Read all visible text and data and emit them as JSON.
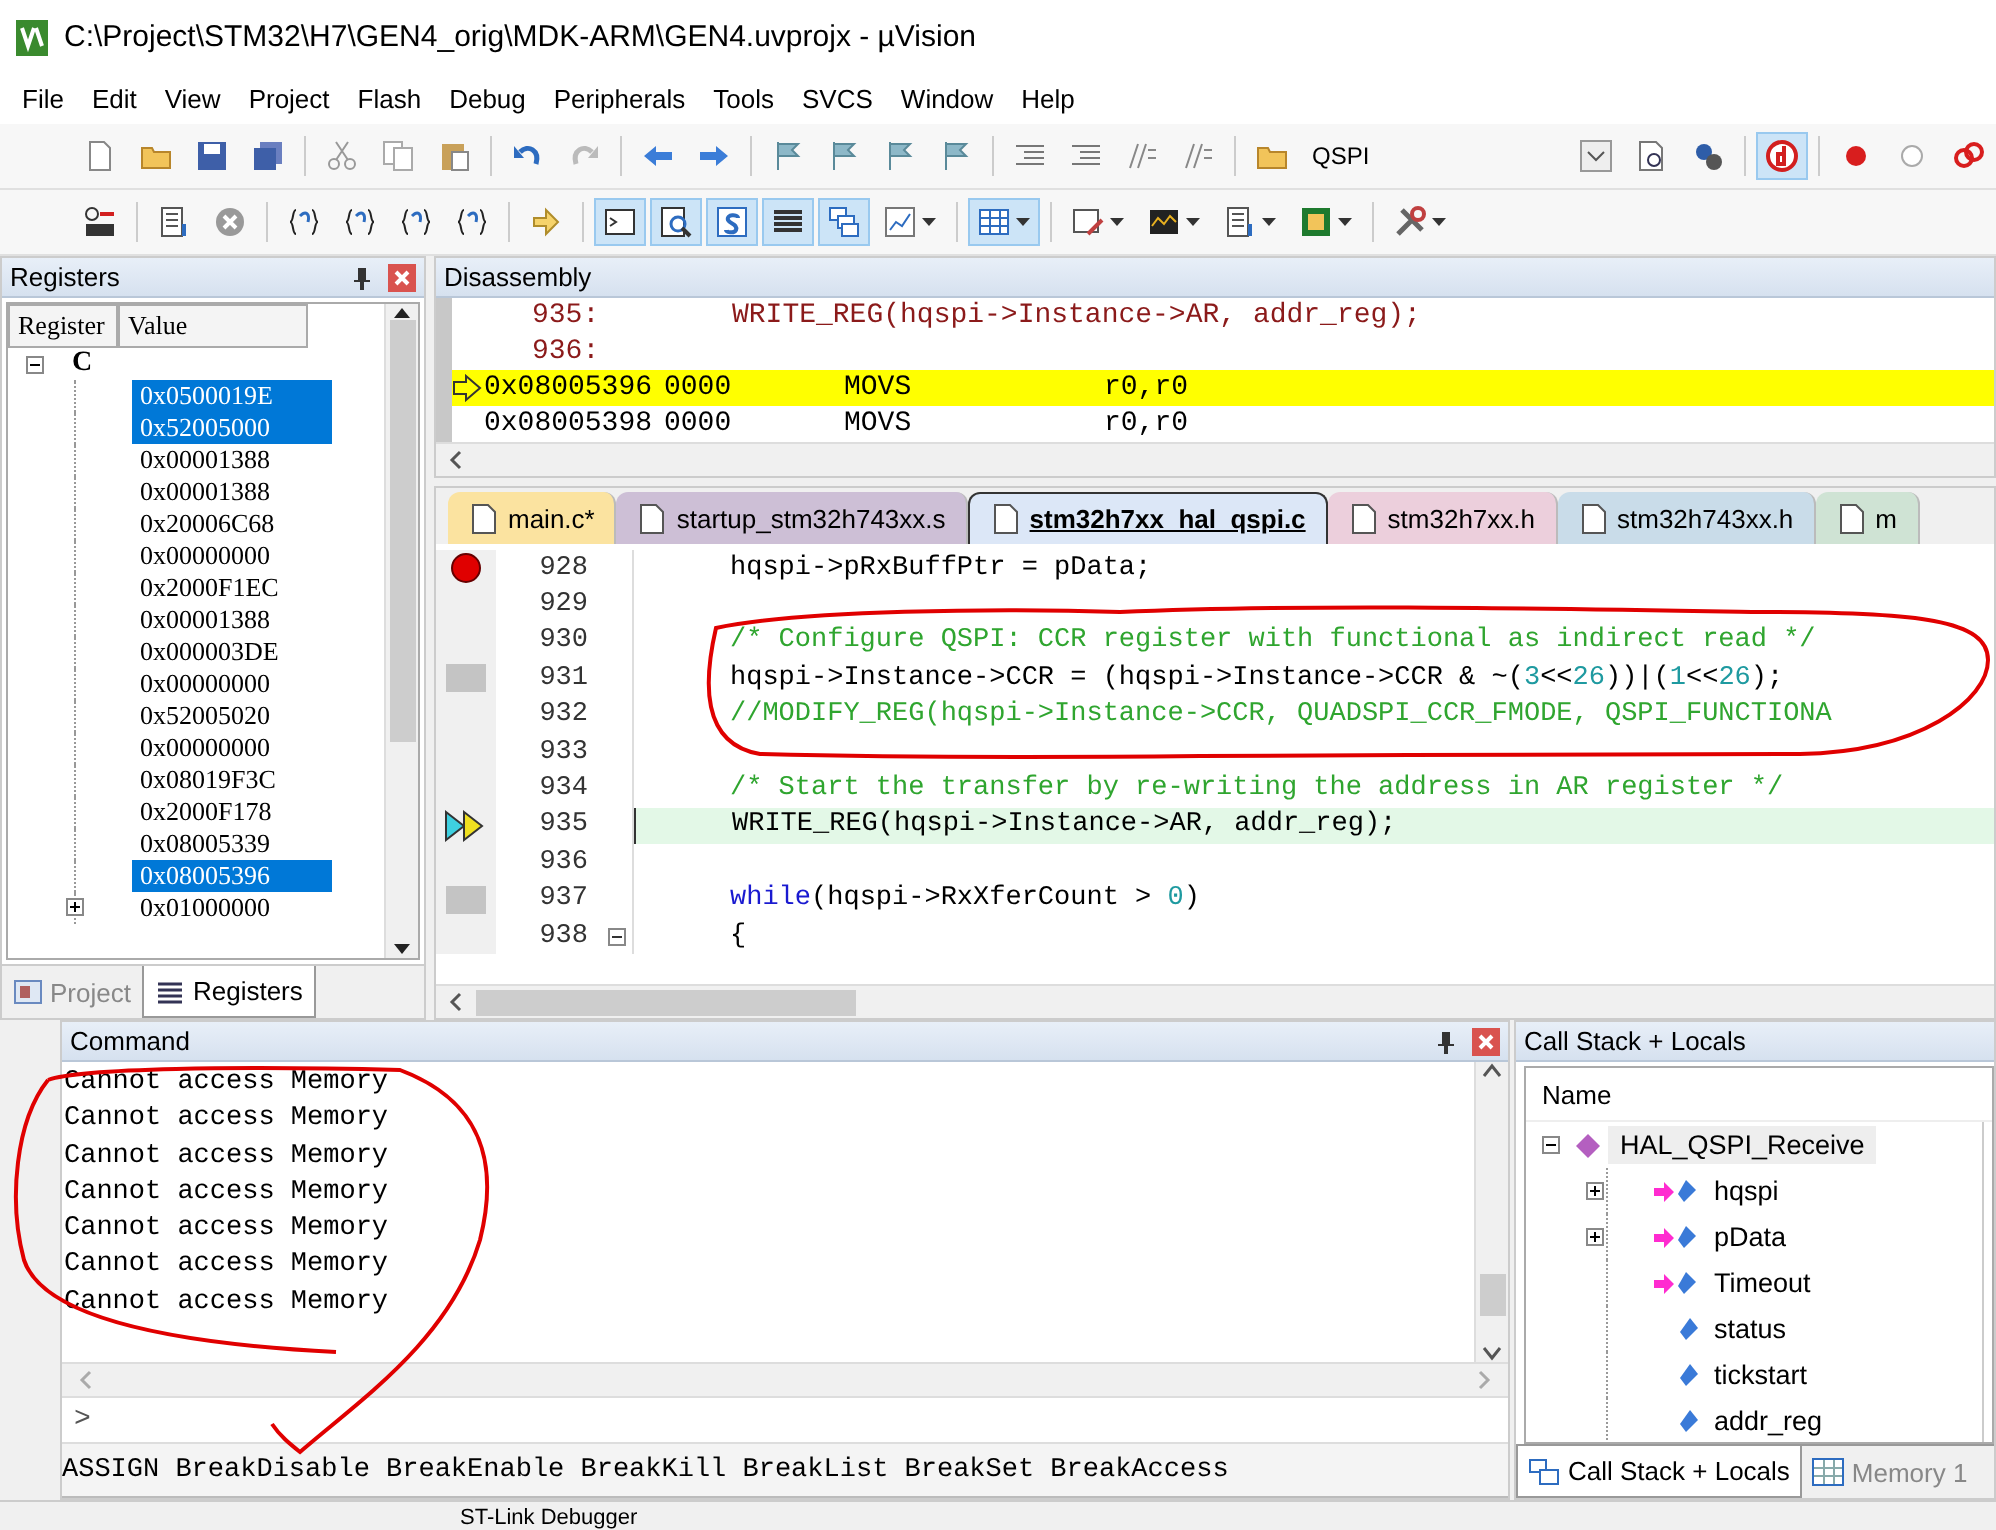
{
  "window": {
    "title": "C:\\Project\\STM32\\H7\\GEN4_orig\\MDK-ARM\\GEN4.uvprojx - µVision"
  },
  "menu": [
    "File",
    "Edit",
    "View",
    "Project",
    "Flash",
    "Debug",
    "Peripherals",
    "Tools",
    "SVCS",
    "Window",
    "Help"
  ],
  "toolbar_1": [
    {
      "kind": "page",
      "pressed": false
    },
    {
      "kind": "folder",
      "pressed": false
    },
    {
      "kind": "disk",
      "pressed": false
    },
    {
      "kind": "disks",
      "pressed": false
    },
    {
      "kind": "sep"
    },
    {
      "kind": "scissors",
      "pressed": false
    },
    {
      "kind": "pages",
      "pressed": false
    },
    {
      "kind": "clipboard",
      "pressed": false
    },
    {
      "kind": "sep"
    },
    {
      "kind": "undo",
      "pressed": false
    },
    {
      "kind": "redo",
      "pressed": false
    },
    {
      "kind": "sep"
    },
    {
      "kind": "left",
      "pressed": false
    },
    {
      "kind": "right",
      "pressed": false
    },
    {
      "kind": "sep"
    },
    {
      "kind": "flag",
      "pressed": false
    },
    {
      "kind": "flag",
      "pressed": false
    },
    {
      "kind": "flag",
      "pressed": false
    },
    {
      "kind": "flag",
      "pressed": false
    },
    {
      "kind": "sep"
    },
    {
      "kind": "lines",
      "pressed": false
    },
    {
      "kind": "lines",
      "pressed": false
    },
    {
      "kind": "slashes",
      "pressed": false
    },
    {
      "kind": "slashes",
      "pressed": false
    },
    {
      "kind": "sep"
    },
    {
      "kind": "folder",
      "pressed": false
    },
    {
      "kind": "target",
      "text": "QSPI"
    },
    {
      "kind": "gap"
    },
    {
      "kind": "select",
      "pressed": false
    },
    {
      "kind": "search",
      "pressed": false
    },
    {
      "kind": "gear",
      "pressed": false
    },
    {
      "kind": "sep"
    },
    {
      "kind": "debug",
      "pressed": true
    },
    {
      "kind": "sep"
    },
    {
      "kind": "dot",
      "pressed": false
    },
    {
      "kind": "ring",
      "pressed": false
    },
    {
      "kind": "chain",
      "pressed": false
    }
  ],
  "toolbar_2": [
    {
      "kind": "reset",
      "pressed": false
    },
    {
      "kind": "sep"
    },
    {
      "kind": "list",
      "pressed": false
    },
    {
      "kind": "stop",
      "pressed": false
    },
    {
      "kind": "sep"
    },
    {
      "kind": "braces",
      "pressed": false
    },
    {
      "kind": "braces",
      "pressed": false
    },
    {
      "kind": "braces",
      "pressed": false
    },
    {
      "kind": "braces",
      "pressed": false
    },
    {
      "kind": "sep"
    },
    {
      "kind": "arrow",
      "pressed": false
    },
    {
      "kind": "sep"
    },
    {
      "kind": "window",
      "pressed": true
    },
    {
      "kind": "magnifier",
      "pressed": true
    },
    {
      "kind": "symbol",
      "pressed": true
    },
    {
      "kind": "rows",
      "pressed": true
    },
    {
      "kind": "stack",
      "pressed": true
    },
    {
      "kind": "chart",
      "pressed": false,
      "dropdown": true
    },
    {
      "kind": "sep"
    },
    {
      "kind": "grid",
      "pressed": true,
      "dropdown": true
    },
    {
      "kind": "sep"
    },
    {
      "kind": "pen",
      "pressed": false,
      "dropdown": true
    },
    {
      "kind": "wave",
      "pressed": false,
      "dropdown": true
    },
    {
      "kind": "list",
      "pressed": false,
      "dropdown": true
    },
    {
      "kind": "chip",
      "pressed": false,
      "dropdown": true
    },
    {
      "kind": "sep"
    },
    {
      "kind": "tools",
      "pressed": false,
      "dropdown": true
    }
  ],
  "registers": {
    "title": "Registers",
    "columns": [
      "Register",
      "Value"
    ],
    "group": {
      "label": "C",
      "expanded": true
    },
    "rows": [
      {
        "value": "0x0500019E",
        "selected": true,
        "expandable": false
      },
      {
        "value": "0x52005000",
        "selected": true,
        "expandable": false
      },
      {
        "value": "0x00001388",
        "selected": false,
        "expandable": false
      },
      {
        "value": "0x00001388",
        "selected": false,
        "expandable": false
      },
      {
        "value": "0x20006C68",
        "selected": false,
        "expandable": false
      },
      {
        "value": "0x00000000",
        "selected": false,
        "expandable": false
      },
      {
        "value": "0x2000F1EC",
        "selected": false,
        "expandable": false
      },
      {
        "value": "0x00001388",
        "selected": false,
        "expandable": false
      },
      {
        "value": "0x000003DE",
        "selected": false,
        "expandable": false
      },
      {
        "value": "0x00000000",
        "selected": false,
        "expandable": false
      },
      {
        "value": "0x52005020",
        "selected": false,
        "expandable": false
      },
      {
        "value": "0x00000000",
        "selected": false,
        "expandable": false
      },
      {
        "value": "0x08019F3C",
        "selected": false,
        "expandable": false
      },
      {
        "value": "0x2000F178",
        "selected": false,
        "expandable": false
      },
      {
        "value": "0x08005339",
        "selected": false,
        "expandable": false
      },
      {
        "value": "0x08005396",
        "selected": true,
        "expandable": false
      },
      {
        "value": "0x01000000",
        "selected": false,
        "expandable": true
      }
    ],
    "tabs": [
      {
        "label": "Project",
        "selected": false
      },
      {
        "label": "Registers",
        "selected": true
      }
    ]
  },
  "disassembly": {
    "title": "Disassembly",
    "lines": [
      {
        "kind": "source",
        "number": "935:",
        "text": "WRITE_REG(hqspi->Instance->AR, addr_reg);",
        "current": false
      },
      {
        "kind": "source",
        "number": "936:",
        "current": false
      },
      {
        "kind": "instruction",
        "address": "0x08005396",
        "opcode": "0000",
        "mnemonic": "MOVS",
        "operands": "r0,r0",
        "current": true
      },
      {
        "kind": "instruction",
        "address": "0x08005398",
        "opcode": "0000",
        "mnemonic": "MOVS",
        "operands": "r0,r0",
        "current": false
      }
    ]
  },
  "editor": {
    "tabs": [
      {
        "label": "main.c*",
        "selected": false,
        "color": "#fbe3a0"
      },
      {
        "label": "startup_stm32h743xx.s",
        "selected": false,
        "color": "#cdbfd6"
      },
      {
        "label": "stm32h7xx_hal_qspi.c",
        "selected": true,
        "color": "#dce7f7"
      },
      {
        "label": "stm32h7xx.h",
        "selected": false,
        "color": "#eccfdc"
      },
      {
        "label": "stm32h743xx.h",
        "selected": false,
        "color": "#c9dce9"
      },
      {
        "label": "m",
        "selected": false,
        "color": "#cfe3d4"
      }
    ],
    "lines": [
      {
        "number": "928",
        "breakpoint": true,
        "executed": false,
        "current": false,
        "fold": false,
        "segments": [
          {
            "kind": "plain",
            "text": "hqspi->pRxBuffPtr = pData;"
          }
        ]
      },
      {
        "number": "929",
        "breakpoint": false,
        "executed": false,
        "current": false,
        "fold": false
      },
      {
        "number": "930",
        "breakpoint": false,
        "executed": false,
        "current": false,
        "fold": false,
        "segments": [
          {
            "kind": "comment",
            "text": "/* Configure QSPI: CCR register with functional as indirect read */"
          }
        ]
      },
      {
        "number": "931",
        "breakpoint": false,
        "executed": true,
        "current": false,
        "fold": false,
        "segments": [
          {
            "kind": "plain",
            "text": "hqspi->Instance->CCR = (hqspi->Instance->CCR & ~("
          },
          {
            "kind": "number",
            "text": "3"
          },
          {
            "kind": "plain",
            "text": "<<"
          },
          {
            "kind": "number",
            "text": "26"
          },
          {
            "kind": "plain",
            "text": "))|("
          },
          {
            "kind": "number",
            "text": "1"
          },
          {
            "kind": "plain",
            "text": "<<"
          },
          {
            "kind": "number",
            "text": "26"
          },
          {
            "kind": "plain",
            "text": ");"
          }
        ]
      },
      {
        "number": "932",
        "breakpoint": false,
        "executed": false,
        "current": false,
        "fold": false,
        "segments": [
          {
            "kind": "comment",
            "text": "//MODIFY_REG(hqspi->Instance->CCR, QUADSPI_CCR_FMODE, QSPI_FUNCTIONA"
          }
        ]
      },
      {
        "number": "933",
        "breakpoint": false,
        "executed": false,
        "current": false,
        "fold": false
      },
      {
        "number": "934",
        "breakpoint": false,
        "executed": false,
        "current": false,
        "fold": false,
        "segments": [
          {
            "kind": "comment",
            "text": "/* Start the transfer by re-writing the address in AR register */"
          }
        ]
      },
      {
        "number": "935",
        "breakpoint": false,
        "executed": false,
        "current": true,
        "fold": false,
        "segments": [
          {
            "kind": "plain",
            "text": "WRITE_REG(hqspi->Instance->AR, addr_reg);"
          }
        ]
      },
      {
        "number": "936",
        "breakpoint": false,
        "executed": false,
        "current": false,
        "fold": false
      },
      {
        "number": "937",
        "breakpoint": false,
        "executed": true,
        "current": false,
        "fold": false,
        "segments": [
          {
            "kind": "keyword",
            "text": "while"
          },
          {
            "kind": "plain",
            "text": "(hqspi->RxXferCount > "
          },
          {
            "kind": "number",
            "text": "0"
          },
          {
            "kind": "plain",
            "text": ")"
          }
        ]
      },
      {
        "number": "938",
        "breakpoint": false,
        "executed": false,
        "current": false,
        "fold": true,
        "segments": [
          {
            "kind": "plain",
            "text": "{"
          }
        ]
      }
    ]
  },
  "command": {
    "title": "Command",
    "output": [
      "Cannot access Memory",
      "Cannot access Memory",
      "Cannot access Memory",
      "Cannot access Memory",
      "Cannot access Memory",
      "Cannot access Memory",
      "Cannot access Memory"
    ],
    "prompt": ">",
    "hints": "ASSIGN BreakDisable BreakEnable BreakKill BreakList BreakSet BreakAccess"
  },
  "call_stack": {
    "title": "Call Stack + Locals",
    "column": "Name",
    "function": {
      "name": "HAL_QSPI_Receive",
      "expanded": true,
      "selected": true,
      "children": [
        {
          "name": "hqspi",
          "kind": "parameter",
          "expandable": true
        },
        {
          "name": "pData",
          "kind": "parameter",
          "expandable": true
        },
        {
          "name": "Timeout",
          "kind": "parameter",
          "expandable": false
        },
        {
          "name": "status",
          "kind": "local",
          "expandable": false
        },
        {
          "name": "tickstart",
          "kind": "local",
          "expandable": false
        },
        {
          "name": "addr_reg",
          "kind": "local",
          "expandable": false
        }
      ]
    },
    "tabs": [
      {
        "label": "Call Stack + Locals",
        "selected": true
      },
      {
        "label": "Memory 1",
        "selected": false
      }
    ]
  },
  "status_bar": {
    "debugger": "ST-Link Debugger"
  }
}
